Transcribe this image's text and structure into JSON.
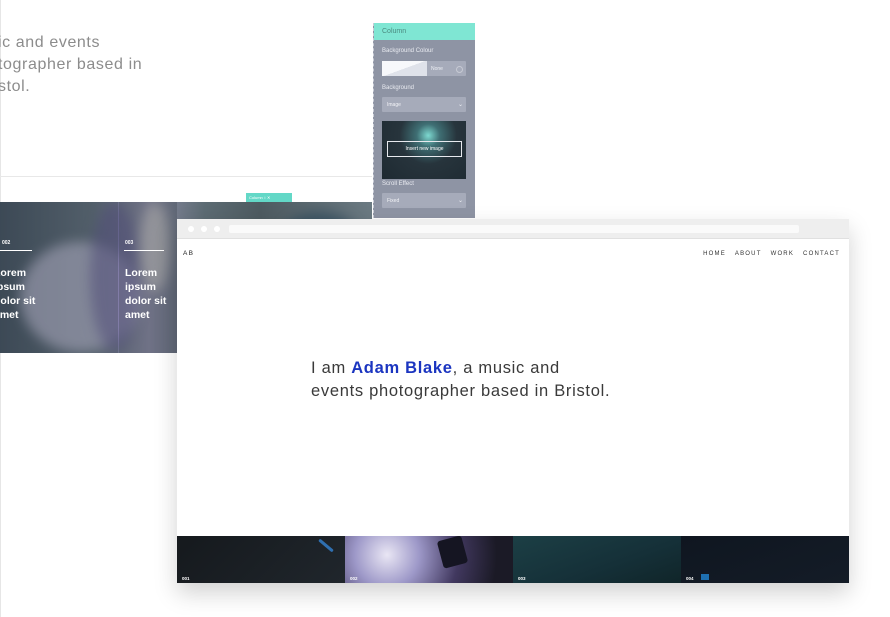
{
  "background_page": {
    "intro_fragment": "ic and events\ntographer based in\nstol.",
    "tiles": [
      {
        "number": "002",
        "text": "Lorem\nipsum\ndolor sit\namet"
      },
      {
        "number": "003",
        "text": "Lorem\nipsum\ndolor sit\namet"
      }
    ],
    "column_chip": "Column"
  },
  "column_panel": {
    "title": "Column",
    "background_colour_label": "Background Colour",
    "background_colour_value": "None",
    "background_label": "Background",
    "background_value": "Image",
    "insert_image_button": "Insert new image",
    "scroll_effect_label": "Scroll Effect",
    "scroll_effect_value": "Fixed"
  },
  "site": {
    "logo": "AB",
    "nav": [
      "HOME",
      "ABOUT",
      "WORK",
      "CONTACT"
    ],
    "intro_before": "I am ",
    "intro_name": "Adam Blake",
    "intro_after": ", a music and events photographer based in Bristol.",
    "gallery": [
      "001",
      "002",
      "003",
      "004"
    ]
  },
  "colors": {
    "accent_teal": "#7fe6d3",
    "name_blue": "#1b35c0",
    "panel_grey": "#8e94a4"
  }
}
